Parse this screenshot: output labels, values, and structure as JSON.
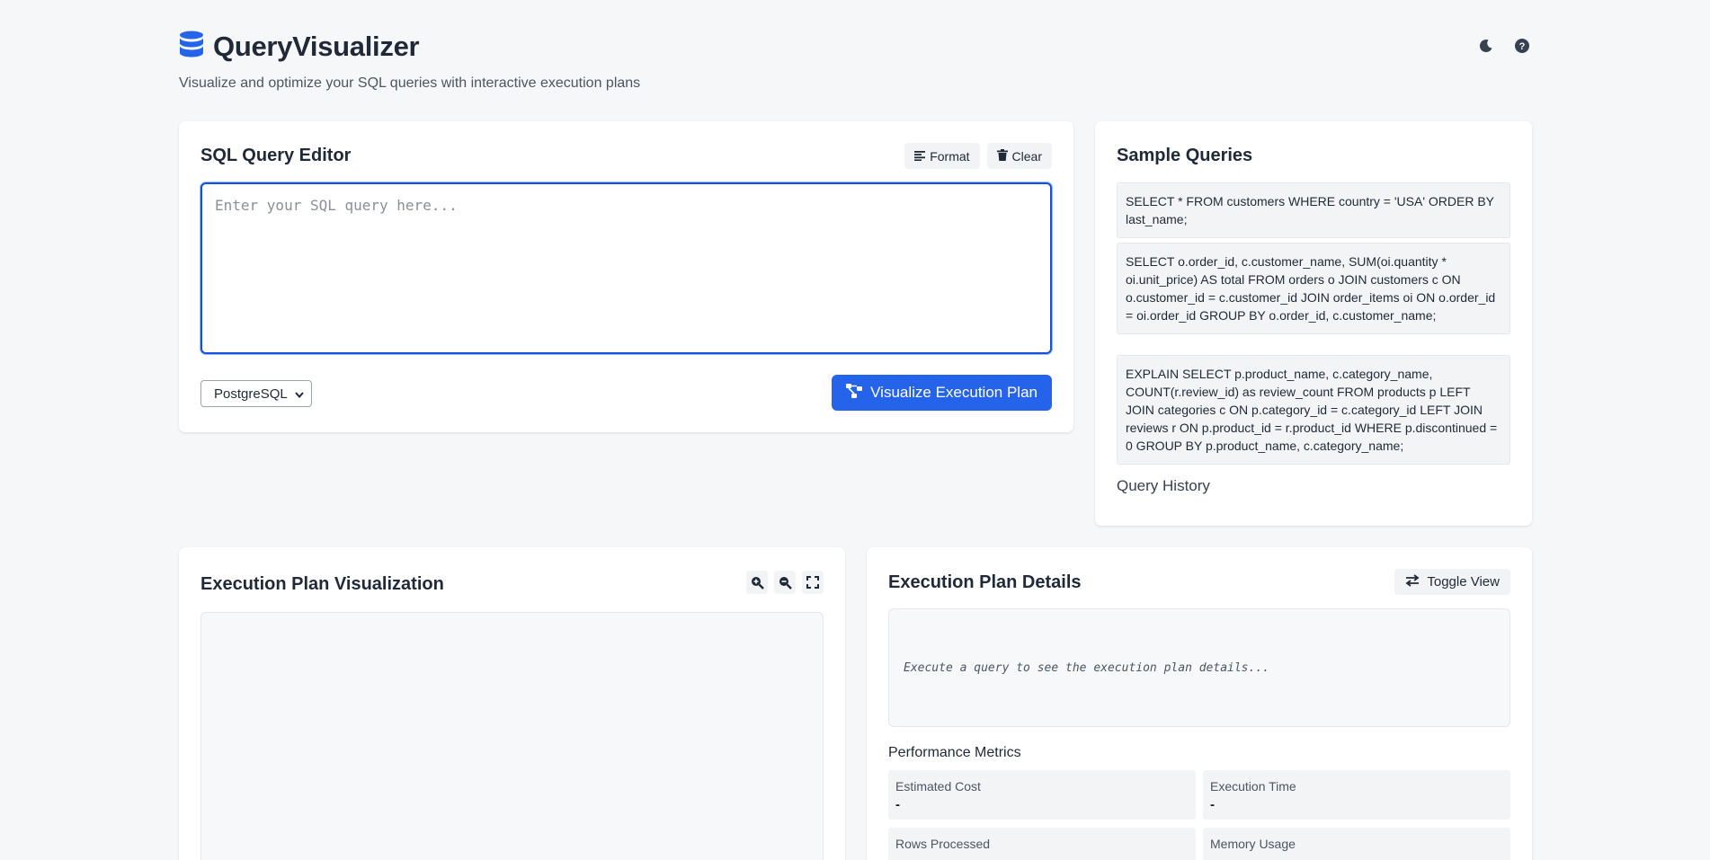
{
  "app": {
    "title": "QueryVisualizer",
    "subtitle": "Visualize and optimize your SQL queries with interactive execution plans",
    "icons": {
      "logo": "database-icon",
      "theme": "moon-icon",
      "help": "question-circle-icon"
    }
  },
  "editor": {
    "title": "SQL Query Editor",
    "format_label": "Format",
    "clear_label": "Clear",
    "query_value": "",
    "placeholder": "Enter your SQL query here...",
    "dialect_selected": "PostgreSQL",
    "visualize_label": "Visualize Execution Plan"
  },
  "samples": {
    "title": "Sample Queries",
    "items": [
      {
        "query": "SELECT * FROM customers WHERE country = 'USA' ORDER BY last_name;"
      },
      {
        "query": "SELECT o.order_id, c.customer_name, SUM(oi.quantity * oi.unit_price) AS total FROM orders o JOIN customers c ON o.customer_id = c.customer_id JOIN order_items oi ON o.order_id = oi.order_id GROUP BY o.order_id, c.customer_name;"
      },
      {
        "query": "EXPLAIN SELECT p.product_name, c.category_name, COUNT(r.review_id) as review_count FROM products p LEFT JOIN categories c ON p.category_id = c.category_id LEFT JOIN reviews r ON p.product_id = r.product_id WHERE p.discontinued = 0 GROUP BY p.product_name, c.category_name;"
      }
    ],
    "history_label": "Query History"
  },
  "visualization": {
    "title": "Execution Plan Visualization",
    "icons": [
      "zoom-in-icon",
      "zoom-out-icon",
      "expand-icon"
    ]
  },
  "details": {
    "title": "Execution Plan Details",
    "toggle_label": "Toggle View",
    "plan_placeholder": "Execute a query to see the execution plan details...",
    "metrics_title": "Performance Metrics",
    "metrics": [
      {
        "label": "Estimated Cost",
        "value": "-"
      },
      {
        "label": "Execution Time",
        "value": "-"
      },
      {
        "label": "Rows Processed",
        "value": "-"
      },
      {
        "label": "Memory Usage",
        "value": "-"
      }
    ]
  },
  "colors": {
    "accent": "#2563eb",
    "background": "#f6f7f9",
    "card": "#ffffff"
  }
}
